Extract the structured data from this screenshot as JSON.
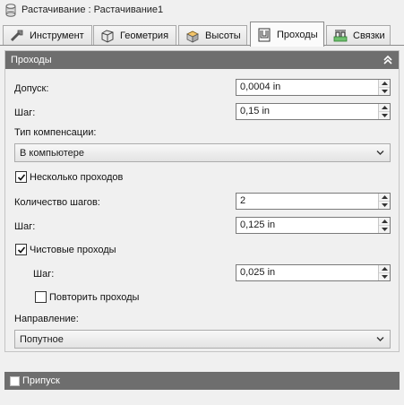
{
  "window": {
    "title": "Растачивание : Растачивание1",
    "icon": "boring-operation-icon"
  },
  "tabs": [
    {
      "label": "Инструмент",
      "icon": "tool-icon",
      "active": false
    },
    {
      "label": "Геометрия",
      "icon": "geometry-icon",
      "active": false
    },
    {
      "label": "Высоты",
      "icon": "heights-icon",
      "active": false
    },
    {
      "label": "Проходы",
      "icon": "passes-icon",
      "active": true
    },
    {
      "label": "Связки",
      "icon": "linking-icon",
      "active": false
    }
  ],
  "passes_section": {
    "title": "Проходы",
    "tolerance": {
      "label": "Допуск:",
      "value": "0,0004 in"
    },
    "step": {
      "label": "Шаг:",
      "value": "0,15 in"
    },
    "compensation": {
      "label": "Тип компенсации:",
      "value": "В компьютере"
    },
    "multiple_passes": {
      "label": "Несколько проходов",
      "checked": true
    },
    "step_count": {
      "label": "Количество шагов:",
      "value": "2"
    },
    "step2": {
      "label": "Шаг:",
      "value": "0,125 in"
    },
    "finishing_passes": {
      "label": "Чистовые проходы",
      "checked": true
    },
    "finishing_step": {
      "label": "Шаг:",
      "value": "0,025 in"
    },
    "repeat_passes": {
      "label": "Повторить проходы",
      "checked": false
    },
    "direction": {
      "label": "Направление:",
      "value": "Попутное"
    }
  },
  "stock_section": {
    "title": "Припуск",
    "checked": false
  },
  "colors": {
    "header_bg": "#6e6e6e",
    "header_text": "#ffffff"
  }
}
